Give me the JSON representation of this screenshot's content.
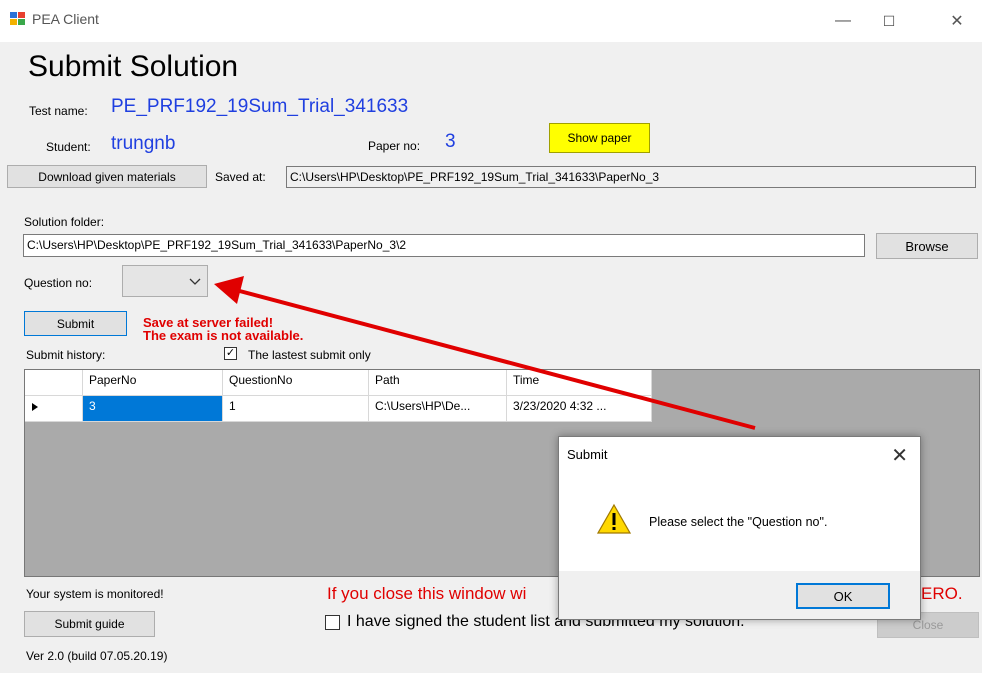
{
  "window": {
    "title": "PEA Client",
    "minimize": "—",
    "maximize": "☐",
    "close": "✕"
  },
  "heading": "Submit Solution",
  "test": {
    "label": "Test name:",
    "value": "PE_PRF192_19Sum_Trial_341633"
  },
  "student": {
    "label": "Student:",
    "value": "trungnb"
  },
  "paper": {
    "label": "Paper no:",
    "value": "3"
  },
  "show_paper_label": "Show paper",
  "download_label": "Download given materials",
  "saved_at": {
    "label": "Saved at:",
    "value": "C:\\Users\\HP\\Desktop\\PE_PRF192_19Sum_Trial_341633\\PaperNo_3"
  },
  "solution_folder": {
    "label": "Solution folder:",
    "value": "C:\\Users\\HP\\Desktop\\PE_PRF192_19Sum_Trial_341633\\PaperNo_3\\2"
  },
  "browse_label": "Browse",
  "question": {
    "label": "Question no:",
    "value": ""
  },
  "submit_label": "Submit",
  "error_lines": [
    "Save at server failed!",
    "The exam is not available."
  ],
  "history": {
    "label": "Submit history:",
    "latest_only_label": "The lastest submit only",
    "latest_only_checked": true,
    "columns": [
      "PaperNo",
      "QuestionNo",
      "Path",
      "Time"
    ],
    "rows": [
      {
        "paper_no": "3",
        "question_no": "1",
        "path": "C:\\Users\\HP\\De...",
        "time": "3/23/2020 4:32 ..."
      }
    ]
  },
  "footer": {
    "monitored": "Your system is monitored!",
    "warning_start": "If you close this window wi",
    "warning_end": "ERO.",
    "submit_guide_label": "Submit guide",
    "signed_label": "I have signed the student list and submitted my solution.",
    "close_label": "Close",
    "version": "Ver 2.0 (build 07.05.20.19)"
  },
  "dialog": {
    "title": "Submit",
    "message": "Please select the \"Question no\".",
    "ok_label": "OK",
    "icon": "warning-icon"
  },
  "annotation": {
    "arrow_color": "#e00000"
  },
  "colors": {
    "accent_blue": "#1f3fe0",
    "error_red": "#e00000",
    "selection": "#0078d7"
  }
}
